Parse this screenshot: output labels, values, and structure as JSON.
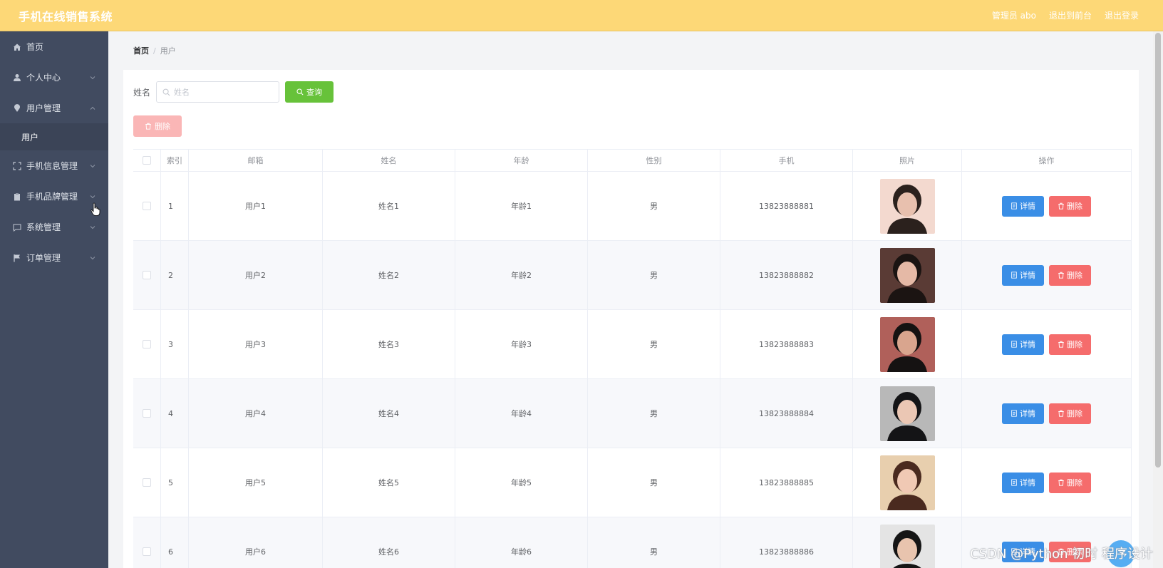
{
  "header": {
    "title": "手机在线销售系统",
    "links": [
      "管理员 abo",
      "退出到前台",
      "退出登录"
    ]
  },
  "sidebar": {
    "items": [
      {
        "label": "首页",
        "icon": "home-icon"
      },
      {
        "label": "个人中心",
        "icon": "user-icon"
      },
      {
        "label": "用户管理",
        "icon": "location-icon",
        "expanded": true,
        "children": [
          "用户"
        ]
      },
      {
        "label": "手机信息管理",
        "icon": "fullscreen-icon"
      },
      {
        "label": "手机品牌管理",
        "icon": "clipboard-icon"
      },
      {
        "label": "系统管理",
        "icon": "message-icon"
      },
      {
        "label": "订单管理",
        "icon": "flag-icon"
      }
    ]
  },
  "breadcrumb": {
    "home": "首页",
    "sep": "/",
    "current": "用户"
  },
  "search": {
    "label": "姓名",
    "placeholder": "姓名",
    "query_label": "查询"
  },
  "toolbar": {
    "delete_label": "删除"
  },
  "table": {
    "columns": [
      "索引",
      "邮箱",
      "姓名",
      "年龄",
      "性别",
      "手机",
      "照片",
      "操作"
    ],
    "detail_label": "详情",
    "delete_label": "删除",
    "rows": [
      {
        "index": "1",
        "email": "用户1",
        "name": "姓名1",
        "age": "年龄1",
        "gender": "男",
        "phone": "13823888881"
      },
      {
        "index": "2",
        "email": "用户2",
        "name": "姓名2",
        "age": "年龄2",
        "gender": "男",
        "phone": "13823888882"
      },
      {
        "index": "3",
        "email": "用户3",
        "name": "姓名3",
        "age": "年龄3",
        "gender": "男",
        "phone": "13823888883"
      },
      {
        "index": "4",
        "email": "用户4",
        "name": "姓名4",
        "age": "年龄4",
        "gender": "男",
        "phone": "13823888884"
      },
      {
        "index": "5",
        "email": "用户5",
        "name": "姓名5",
        "age": "年龄5",
        "gender": "男",
        "phone": "13823888885"
      },
      {
        "index": "6",
        "email": "用户6",
        "name": "姓名6",
        "age": "年龄6",
        "gender": "男",
        "phone": "13823888886"
      }
    ]
  },
  "colors": {
    "header_bg": "#fdd877",
    "sidebar_bg": "#414b60",
    "query_btn": "#67c23a",
    "detail_btn": "#3a8ee6",
    "delete_btn": "#f56c6c"
  },
  "watermark": "CSDN @Python 初时 程序设计"
}
